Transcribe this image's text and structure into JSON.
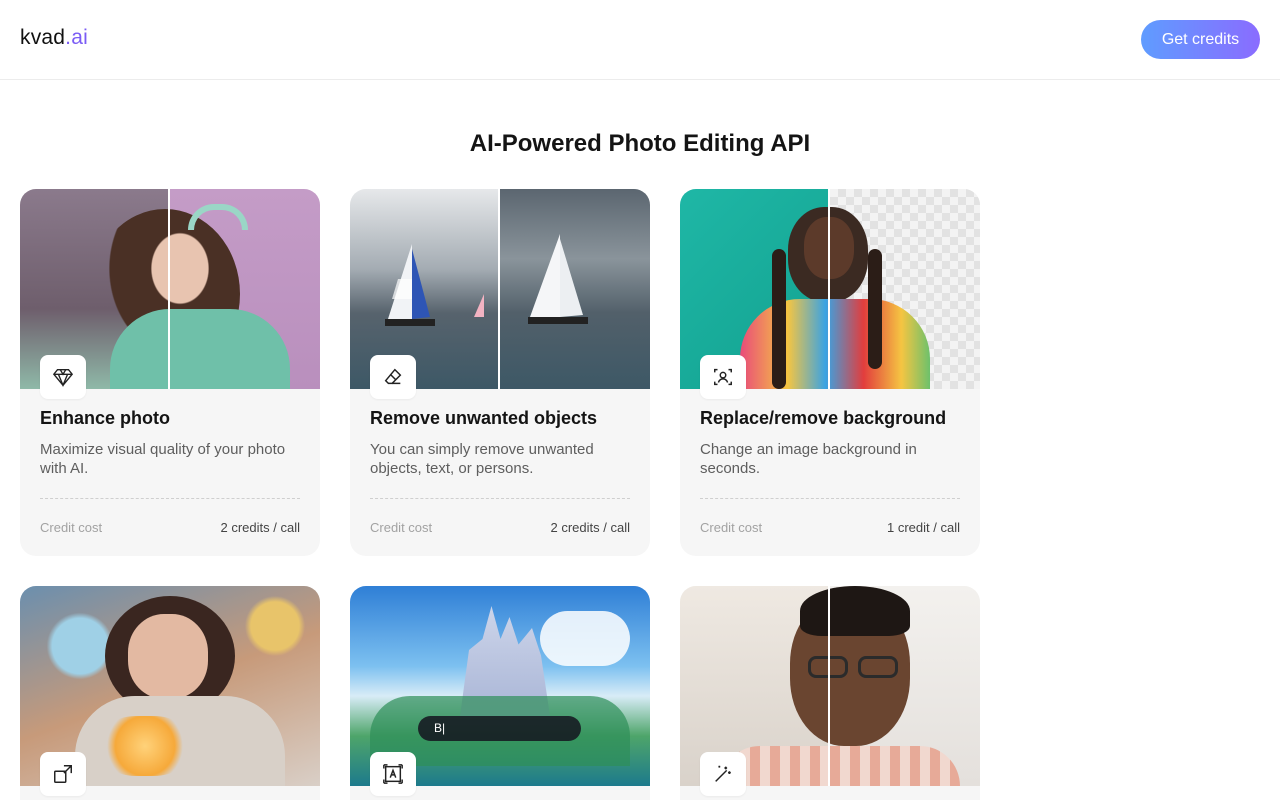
{
  "header": {
    "logo": {
      "main": "kvad",
      "dot": ".",
      "suffix": "ai"
    },
    "cta_label": "Get credits"
  },
  "page_title": "AI-Powered Photo Editing API",
  "credit_label": "Credit cost",
  "cards": [
    {
      "title": "Enhance photo",
      "description": "Maximize visual quality of your photo with AI.",
      "credit": "2 credits / call",
      "icon": "diamond-icon"
    },
    {
      "title": "Remove unwanted objects",
      "description": "You can simply remove unwanted objects, text, or persons.",
      "credit": "2 credits / call",
      "icon": "eraser-icon"
    },
    {
      "title": "Replace/remove background",
      "description": "Change an image background in seconds.",
      "credit": "1 credit / call",
      "icon": "portrait-focus-icon"
    },
    {
      "title": "",
      "description": "",
      "credit": "",
      "icon": "expand-image-icon"
    },
    {
      "title": "",
      "description": "",
      "credit": "",
      "icon": "text-frame-icon",
      "prompt_text": "B|"
    },
    {
      "title": "",
      "description": "",
      "credit": "",
      "icon": "magic-wand-icon"
    }
  ],
  "colors": {
    "accent": "#7b5cf5",
    "cta_start": "#5f9cff",
    "cta_end": "#8a6cff",
    "card_bg": "#f6f6f6"
  }
}
